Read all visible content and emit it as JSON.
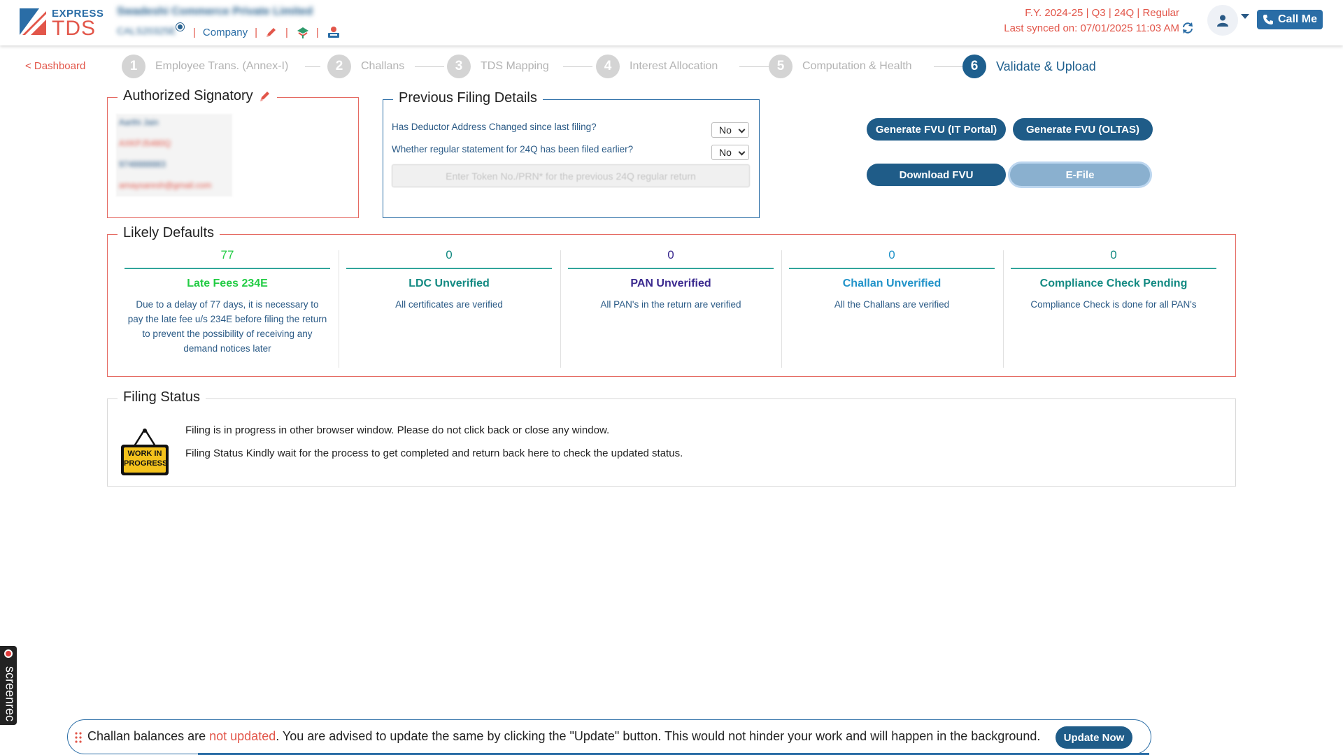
{
  "header": {
    "logo_top": "EXPRESS",
    "logo_bottom": "TDS",
    "company_name": "Swadeshi Commerce Private Limited",
    "company_tan": "CALS20325E",
    "company_link": "Company",
    "separator": "|",
    "fy_info": "F.Y. 2024-25  | Q3  | 24Q | Regular",
    "last_synced": "Last synced on: 07/01/2025 11:03 AM",
    "call_me": "Call Me"
  },
  "nav": {
    "back_link": "< Dashboard",
    "steps": [
      {
        "num": "1",
        "label": "Employee Trans. (Annex-I)"
      },
      {
        "num": "2",
        "label": "Challans"
      },
      {
        "num": "3",
        "label": "TDS Mapping"
      },
      {
        "num": "4",
        "label": "Interest Allocation"
      },
      {
        "num": "5",
        "label": "Computation & Health"
      },
      {
        "num": "6",
        "label": "Validate & Upload"
      }
    ]
  },
  "signatory": {
    "title": "Authorized Signatory",
    "name": "Aarthi Jain",
    "pan": "AXKPJ5480Q",
    "phone": "9748888883",
    "email": "amaysaresh@gmail.com"
  },
  "previous_filing": {
    "title": "Previous Filing Details",
    "q1": "Has Deductor Address Changed since last filing?",
    "q1_value": "No",
    "q2": "Whether regular statement for 24Q has been filed earlier?",
    "q2_value": "No",
    "token_placeholder": "Enter Token No./PRN* for the previous 24Q regular return"
  },
  "actions": {
    "gen_it": "Generate FVU (IT Portal)",
    "gen_oltas": "Generate FVU (OLTAS)",
    "download": "Download FVU",
    "efile": "E-File"
  },
  "likely_defaults": {
    "title": "Likely Defaults",
    "items": [
      {
        "value": "77",
        "title": "Late Fees 234E",
        "desc": "Due to a delay of 77 days, it is necessary to pay the late fee u/s 234E before filing the return to prevent the possibility of receiving any demand notices later",
        "color": "#22cc44"
      },
      {
        "value": "0",
        "title": "LDC Unverified",
        "desc": "All certificates are verified",
        "color": "#138a82"
      },
      {
        "value": "0",
        "title": "PAN Unverified",
        "desc": "All PAN's in the return are verified",
        "color": "#3b2a8f"
      },
      {
        "value": "0",
        "title": "Challan Unverified",
        "desc": "All the Challans are verified",
        "color": "#2193c9"
      },
      {
        "value": "0",
        "title": "Compliance Check Pending",
        "desc": "Compliance Check is done for all PAN's",
        "color": "#138a82"
      }
    ]
  },
  "filing_status": {
    "title": "Filing Status",
    "line1": "Filing is in progress in other browser window. Please do not click back or close any window.",
    "line2": "Filing Status Kindly wait for the process to get completed and return back here to check the updated status.",
    "sign_top": "WORK IN",
    "sign_bottom": "PROGRESS"
  },
  "recorder": {
    "label": "screenrec"
  },
  "notice": {
    "pre": "Challan balances are ",
    "highlight": "not updated",
    "post": ". You are advised to update the same by clicking the \"Update\" button. This would not hinder your work and will happen in the background.",
    "button": "Update Now"
  },
  "colors": {
    "brand_blue": "#2a6da6",
    "brand_red": "#e2564a",
    "dark_blue": "#1f5c88"
  }
}
